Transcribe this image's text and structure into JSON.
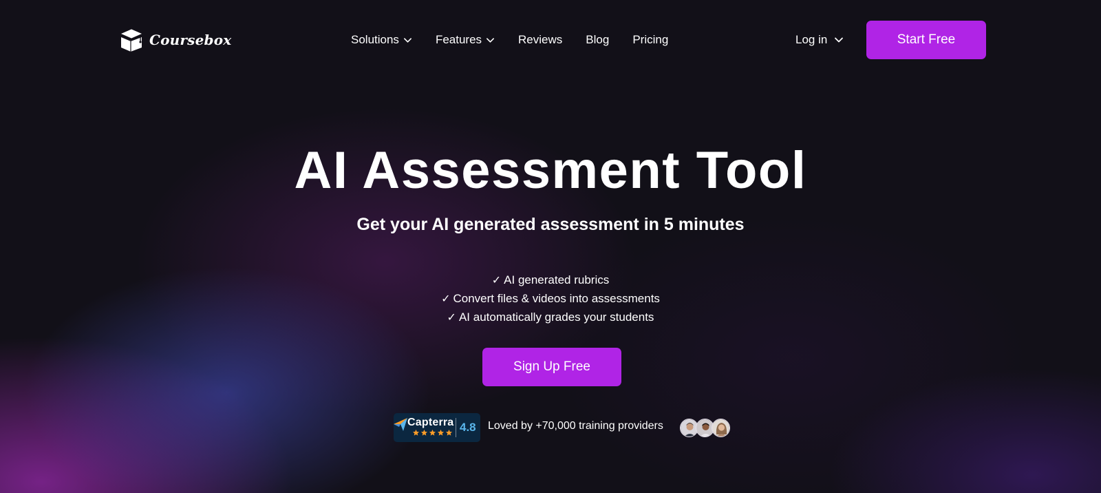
{
  "brand": {
    "name": "Coursebox",
    "logo_icon": "graduation-cap-box-icon"
  },
  "nav": {
    "items": [
      {
        "label": "Solutions",
        "has_dropdown": true
      },
      {
        "label": "Features",
        "has_dropdown": true
      },
      {
        "label": "Reviews",
        "has_dropdown": false
      },
      {
        "label": "Blog",
        "has_dropdown": false
      },
      {
        "label": "Pricing",
        "has_dropdown": false
      }
    ],
    "login_label": "Log in",
    "cta_label": "Start Free"
  },
  "hero": {
    "title": "AI Assessment Tool",
    "subtitle": "Get your AI generated assessment in 5 minutes",
    "features": [
      "AI generated rubrics",
      "Convert files & videos into assessments",
      "AI automatically grades your students"
    ],
    "check_glyph": "✓",
    "cta_label": "Sign Up Free"
  },
  "social_proof": {
    "capterra_name": "Capterra",
    "capterra_rating": "4.8",
    "star_count": 5,
    "loved_text": "Loved by +70,000 training providers",
    "avatar_count": 3
  },
  "colors": {
    "accent": "#b024e6",
    "background": "#121018",
    "capterra_bg": "#0b2740",
    "capterra_rating": "#5ab6ec",
    "star": "#ff9d28"
  }
}
